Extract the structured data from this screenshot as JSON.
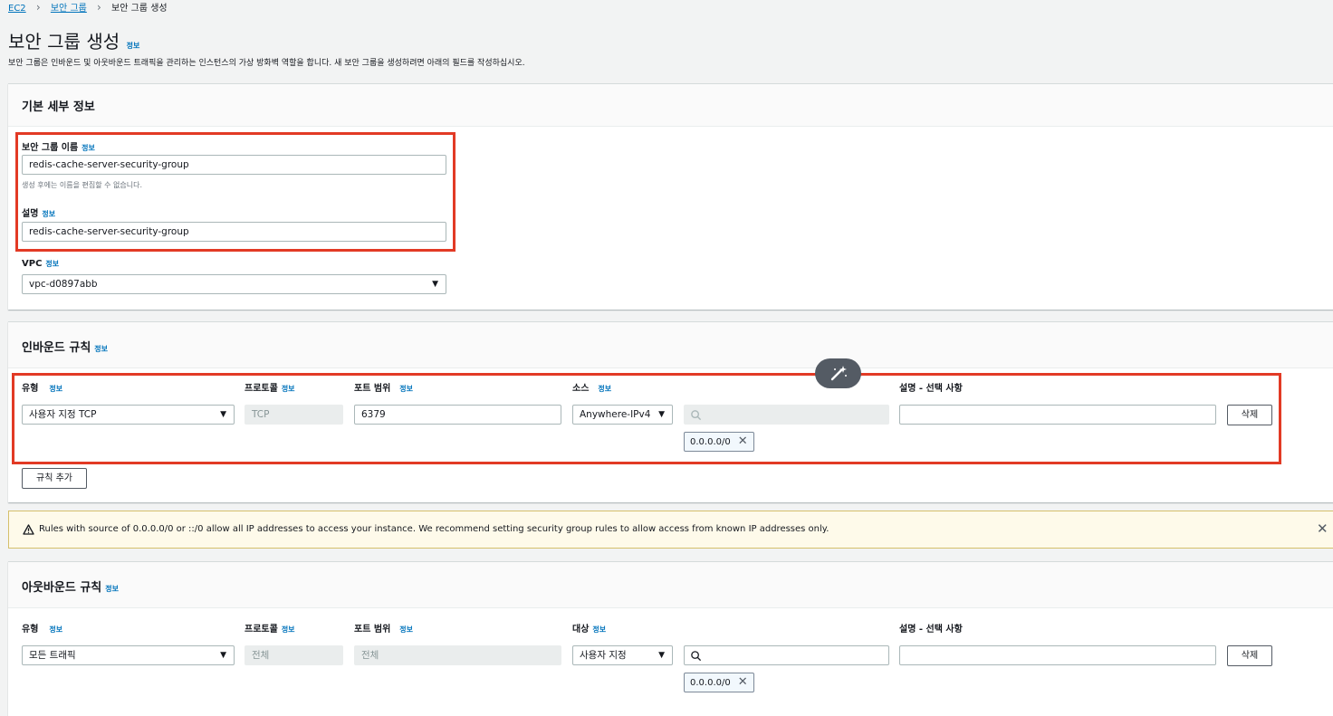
{
  "breadcrumb": {
    "ec2": "EC2",
    "security_groups": "보안 그룹",
    "current": "보안 그룹 생성"
  },
  "page": {
    "title": "보안 그룹 생성",
    "info": "정보",
    "description": "보안 그룹은 인바운드 및 아웃바운드 트래픽을 관리하는 인스턴스의 가상 방화벽 역할을 합니다. 새 보안 그룹을 생성하려면 아래의 필드를 작성하십시오."
  },
  "basic": {
    "title": "기본 세부 정보",
    "name_label": "보안 그룹 이름",
    "name_value": "redis-cache-server-security-group",
    "name_hint": "생성 후에는 이름을 편집할 수 없습니다.",
    "desc_label": "설명",
    "desc_value": "redis-cache-server-security-group",
    "vpc_label": "VPC",
    "vpc_value": "vpc-d0897abb"
  },
  "inbound": {
    "title": "인바운드 규칙",
    "col_type": "유형",
    "col_protocol": "프로토콜",
    "col_port": "포트 범위",
    "col_source": "소스",
    "col_desc": "설명 - 선택 사항",
    "type_value": "사용자 지정 TCP",
    "protocol_value": "TCP",
    "port_value": "6379",
    "source_value": "Anywhere-IPv4",
    "search_placeholder": "",
    "cidr": "0.0.0.0/0",
    "delete_label": "삭제",
    "add_rule_label": "규칙 추가"
  },
  "warning": {
    "text": "Rules with source of 0.0.0.0/0 or ::/0 allow all IP addresses to access your instance. We recommend setting security group rules to allow access from known IP addresses only."
  },
  "outbound": {
    "title": "아웃바운드 규칙",
    "col_type": "유형",
    "col_protocol": "프로토콜",
    "col_port": "포트 범위",
    "col_dest": "대상",
    "col_desc": "설명 - 선택 사항",
    "type_value": "모든 트래픽",
    "protocol_value": "전체",
    "port_value": "전체",
    "dest_value": "사용자 지정",
    "cidr": "0.0.0.0/0",
    "delete_label": "삭제"
  },
  "colors": {
    "link": "#0073bb",
    "highlight": "#e23a25",
    "warning_bg": "#fefaea"
  },
  "icons": [
    "chevron-right-icon",
    "caret-down-icon",
    "search-icon",
    "close-icon",
    "warning-icon",
    "magic-wand-icon"
  ]
}
